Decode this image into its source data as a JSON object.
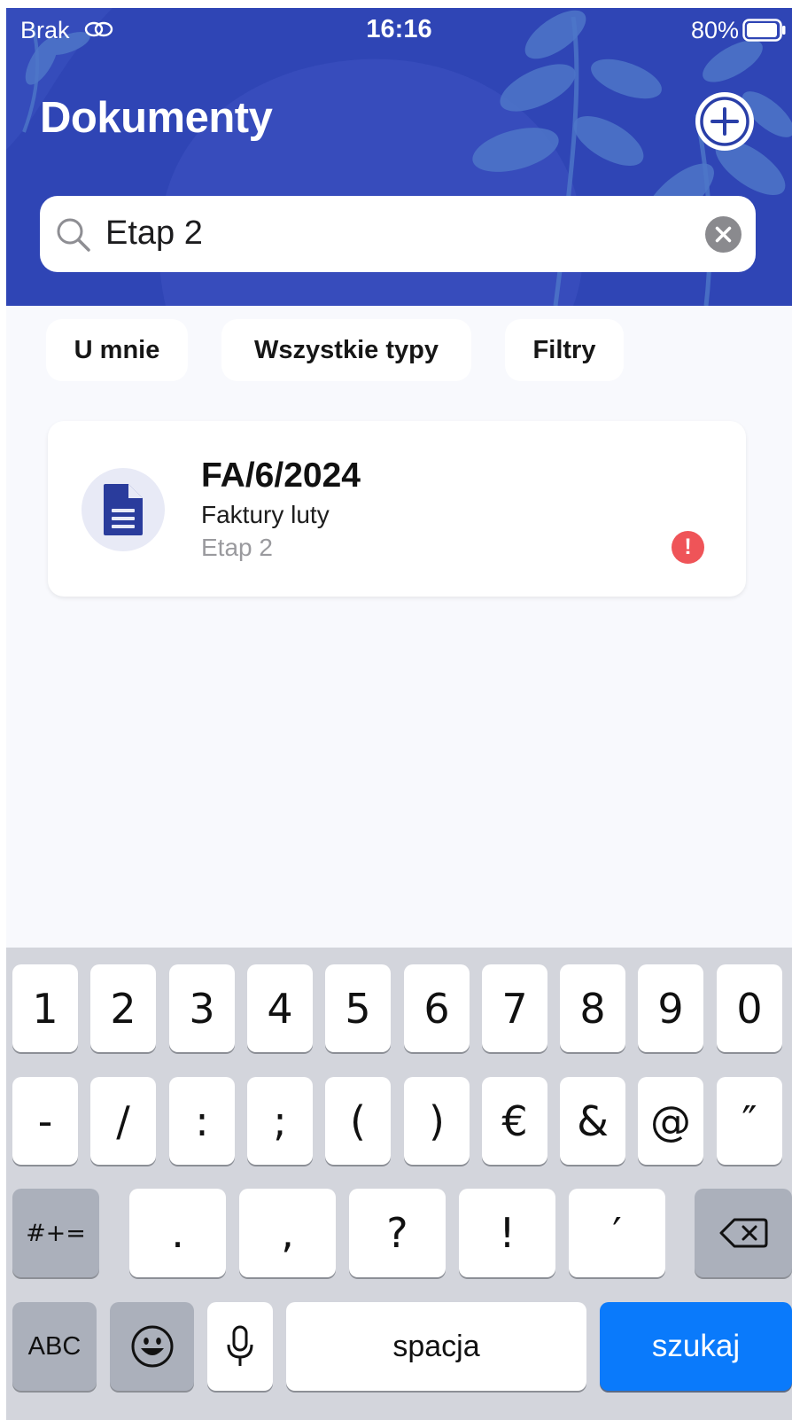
{
  "status_bar": {
    "carrier": "Brak",
    "time": "16:16",
    "battery": "80%"
  },
  "header": {
    "title": "Dokumenty"
  },
  "search": {
    "value": "Etap 2"
  },
  "filters": [
    "U mnie",
    "Wszystkie typy",
    "Filtry"
  ],
  "documents": [
    {
      "number": "FA/6/2024",
      "name": "Faktury luty",
      "stage": "Etap 2",
      "alert": "!"
    }
  ],
  "keyboard": {
    "row1": [
      "1",
      "2",
      "3",
      "4",
      "5",
      "6",
      "7",
      "8",
      "9",
      "0"
    ],
    "row2": [
      "-",
      "/",
      ":",
      ";",
      "(",
      ")",
      "€",
      "&",
      "@",
      "″"
    ],
    "row3_mode": "#+=",
    "row3": [
      ".",
      ",",
      "?",
      "!",
      "′"
    ],
    "abc": "ABC",
    "space": "spacja",
    "search": "szukaj"
  },
  "colors": {
    "header_bg": "#2f45b5",
    "accent": "#0a7afb",
    "alert": "#ef5458"
  }
}
